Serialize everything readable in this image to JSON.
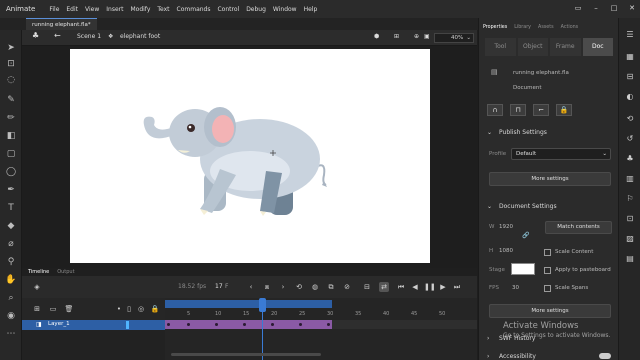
{
  "app_name": "Animate",
  "menu": [
    "File",
    "Edit",
    "View",
    "Insert",
    "Modify",
    "Text",
    "Commands",
    "Control",
    "Debug",
    "Window",
    "Help"
  ],
  "doc_tab": "running elephant.fla*",
  "editbar": {
    "scene": "Scene 1",
    "symbol": "elephant foot",
    "zoom": "40%"
  },
  "timeline": {
    "tabs": [
      "Timeline",
      "Output"
    ],
    "fps": "18.52 fps",
    "current_frame": "17",
    "frame_label_suffix": "F",
    "ruler_numbers": [
      "5",
      "10",
      "15",
      "20",
      "25",
      "30",
      "35",
      "40",
      "45",
      "50"
    ],
    "layer_name": "Layer_1",
    "tween_end_frame": 30,
    "playhead_frame": 17
  },
  "panel": {
    "tabs": [
      "Properties",
      "Library",
      "Assets",
      "Actions"
    ],
    "active_tab": "Properties",
    "subtabs": [
      "Tool",
      "Object",
      "Frame",
      "Doc"
    ],
    "active_subtab": "Doc",
    "doc_name": "running elephant.fla",
    "doc_kind": "Document",
    "publish_header": "Publish Settings",
    "profile_label": "Profile",
    "profile_value": "Default",
    "more_settings": "More settings",
    "doc_settings_header": "Document Settings",
    "width_label": "W",
    "width_value": "1920",
    "height_label": "H",
    "height_value": "1080",
    "match_contents": "Match contents",
    "scale_content": "Scale Content",
    "stage_label": "Stage",
    "apply_pasteboard": "Apply to pasteboard",
    "fps_label": "FPS",
    "fps_value": "30",
    "scale_spans": "Scale Spans",
    "more_settings_2": "More settings",
    "swf_history": "SWF History",
    "accessibility": "Accessibility"
  },
  "watermark": {
    "line1": "Activate Windows",
    "line2": "Go to Settings to activate Windows."
  },
  "colors": {
    "accent": "#3a7bd5",
    "tween": "#8a5aa5",
    "stage": "#ffffff"
  }
}
